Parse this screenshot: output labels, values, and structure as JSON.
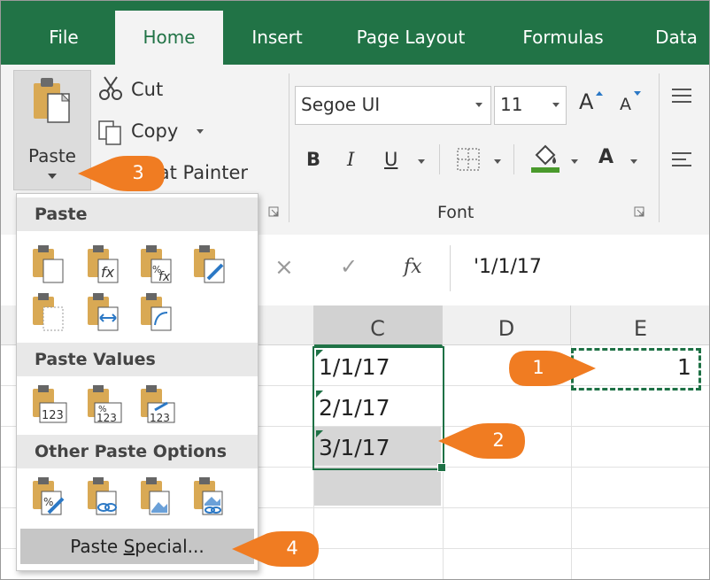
{
  "tabs": [
    "File",
    "Home",
    "Insert",
    "Page Layout",
    "Formulas",
    "Data"
  ],
  "clipboard": {
    "paste_label": "Paste",
    "cut_label": "Cut",
    "copy_label": "Copy",
    "format_painter_label": "rmat Painter"
  },
  "font_group": {
    "font_name": "Segoe UI",
    "font_size": "11",
    "grow_label": "A",
    "shrink_label": "A",
    "bold": "B",
    "italic": "I",
    "underline": "U",
    "font_color_label": "A",
    "group_label": "Font"
  },
  "formula_bar": {
    "cancel": "×",
    "enter": "✓",
    "fx": "fx",
    "content": "'1/1/17"
  },
  "grid": {
    "columns": [
      "C",
      "D",
      "E"
    ],
    "cells": {
      "c1": "1/1/17",
      "c2": "2/1/17",
      "c3": "3/1/17",
      "e1": "1"
    }
  },
  "paste_menu": {
    "paste_header": "Paste",
    "values_header": "Paste Values",
    "other_header": "Other Paste Options",
    "special_prefix": "Paste ",
    "special_underline": "S",
    "special_suffix": "pecial...",
    "icon_label_123": "123"
  },
  "callouts": [
    "1",
    "2",
    "3",
    "4"
  ],
  "colors": {
    "excel_green": "#217346",
    "callout_orange": "#f07c22",
    "selection_green": "#1e7145"
  }
}
